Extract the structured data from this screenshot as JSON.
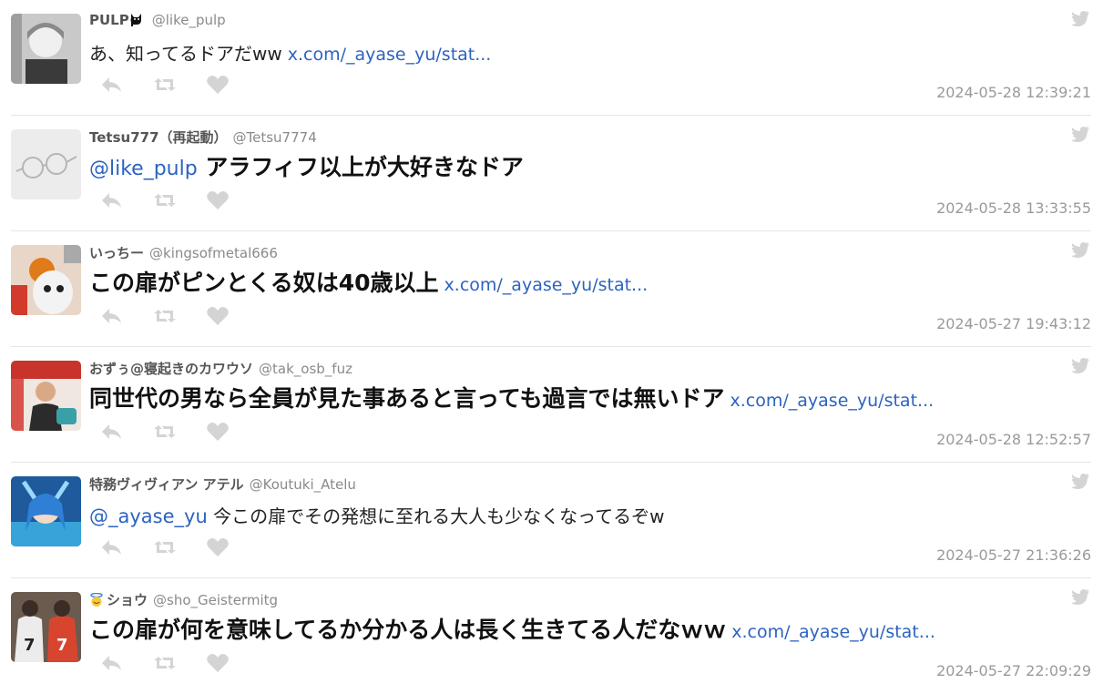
{
  "tweets": [
    {
      "display_name": "PULP",
      "name_emoji": "black-cat",
      "handle": "@like_pulp",
      "text": "あ、知ってるドアだww",
      "mention": "",
      "link": "x.com/_ayase_yu/stat...",
      "timestamp": "2024-05-28 12:39:21",
      "large": false
    },
    {
      "display_name": "Tetsu777（再起動）",
      "name_emoji": "",
      "handle": "@Tetsu7774",
      "mention": "@like_pulp",
      "text": "アラフィフ以上が大好きなドア",
      "link": "",
      "timestamp": "2024-05-28 13:33:55",
      "large": true
    },
    {
      "display_name": "いっちー",
      "name_emoji": "",
      "handle": "@kingsofmetal666",
      "mention": "",
      "text": "この扉がピンとくる奴は40歳以上",
      "link": "x.com/_ayase_yu/stat...",
      "timestamp": "2024-05-27 19:43:12",
      "large": true
    },
    {
      "display_name": "おずぅ@寝起きのカワウソ",
      "name_emoji": "",
      "handle": "@tak_osb_fuz",
      "mention": "",
      "text": "同世代の男なら全員が見た事あると言っても過言では無いドア",
      "link": "x.com/_ayase_yu/stat...",
      "timestamp": "2024-05-28 12:52:57",
      "large": true
    },
    {
      "display_name": "特務ヴィヴィアン アテル",
      "name_emoji": "",
      "handle": "@Koutuki_Atelu",
      "mention": "@_ayase_yu",
      "text": "今この扉でその発想に至れる大人も少なくなってるぞw",
      "link": "",
      "timestamp": "2024-05-27 21:36:26",
      "large": false
    },
    {
      "display_name": "ショウ",
      "name_emoji": "smiling-face-with-halo",
      "handle": "@sho_Geistermitg",
      "mention": "",
      "text": "この扉が何を意味してるか分かる人は長く生きてる人だなｗｗ",
      "link": "x.com/_ayase_yu/stat...",
      "timestamp": "2024-05-27 22:09:29",
      "large": true
    }
  ],
  "colors": {
    "link": "#2c63c0",
    "meta": "#8a8a8a",
    "icon": "#d4d4d4",
    "divider": "#e6e6e6"
  }
}
